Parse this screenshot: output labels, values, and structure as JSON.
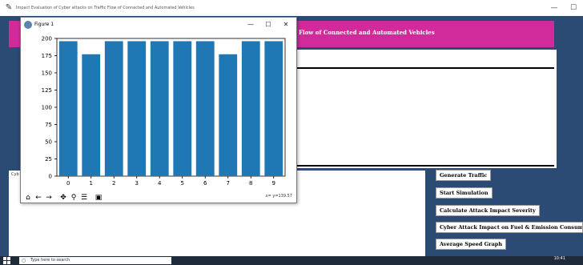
{
  "window": {
    "title": "Impact Evaluation of Cyber attacks on Traffic Flow of Connected and Automated Vehicles",
    "minimize": "—",
    "maximize": "☐"
  },
  "header": {
    "text": "Flow of Connected and Automated Vehicles"
  },
  "left_panel": {
    "label": "Cyb"
  },
  "buttons": {
    "generate": "Generate Traffic",
    "start": "Start Simulation",
    "calculate": "Calculate Attack Impact Severity",
    "cyber": "Cyber Attack Impact on Fuel & Emission Consump",
    "average": "Average Speed Graph"
  },
  "figure": {
    "title": "Figure 1",
    "minimize": "—",
    "maximize": "☐",
    "close": "✕",
    "coord_readout": "x= y=139.57"
  },
  "chart_data": {
    "type": "bar",
    "categories": [
      "0",
      "1",
      "2",
      "3",
      "4",
      "5",
      "6",
      "7",
      "8",
      "9"
    ],
    "values": [
      196,
      177,
      196,
      196,
      196,
      196,
      196,
      177,
      196,
      196
    ],
    "title": "",
    "xlabel": "",
    "ylabel": "",
    "ylim": [
      0,
      200
    ],
    "yticks": [
      0,
      25,
      50,
      75,
      100,
      125,
      150,
      175,
      200
    ],
    "bar_color": "#1f77b4",
    "grid": false
  },
  "taskbar": {
    "search_placeholder": "Type here to search",
    "time": "10:41"
  },
  "colors": {
    "app_background": "#2b4a74",
    "header_band": "#d12a9a"
  }
}
